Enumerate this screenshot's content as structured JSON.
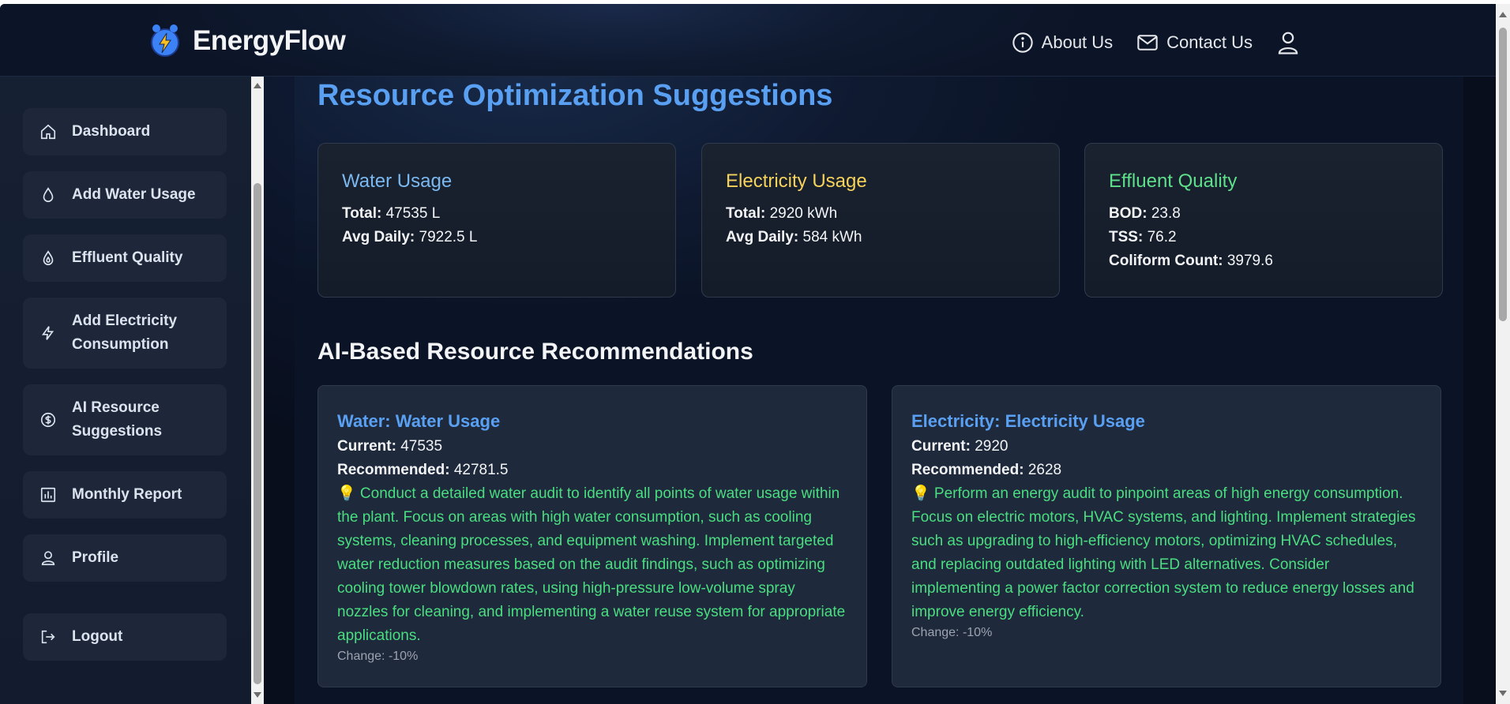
{
  "brand": {
    "name": "EnergyFlow"
  },
  "nav": {
    "about": "About Us",
    "contact": "Contact Us"
  },
  "sidebar": {
    "items": [
      {
        "label": "Dashboard",
        "icon": "home-icon"
      },
      {
        "label": "Add Water Usage",
        "icon": "droplet-icon"
      },
      {
        "label": "Effluent Quality",
        "icon": "flame-drop-icon"
      },
      {
        "label": "Add Electricity Consumption",
        "icon": "bolt-icon"
      },
      {
        "label": "AI Resource Suggestions",
        "icon": "dollar-circle-icon"
      },
      {
        "label": "Monthly Report",
        "icon": "bar-chart-icon"
      },
      {
        "label": "Profile",
        "icon": "user-icon"
      },
      {
        "label": "Logout",
        "icon": "logout-icon"
      }
    ]
  },
  "page": {
    "title": "Resource Optimization Suggestions"
  },
  "stats": {
    "water": {
      "title": "Water Usage",
      "total_label": "Total:",
      "total": "47535 L",
      "avg_label": "Avg Daily:",
      "avg": "7922.5 L",
      "color": "#7ab8ef"
    },
    "electricity": {
      "title": "Electricity Usage",
      "total_label": "Total:",
      "total": "2920 kWh",
      "avg_label": "Avg Daily:",
      "avg": "584 kWh",
      "color": "#f6d25a"
    },
    "effluent": {
      "title": "Effluent Quality",
      "bod_label": "BOD:",
      "bod": "23.8",
      "tss_label": "TSS:",
      "tss": "76.2",
      "coliform_label": "Coliform Count:",
      "coliform": "3979.6",
      "color": "#5ee08a"
    }
  },
  "recommendations": {
    "section_title": "AI-Based Resource Recommendations",
    "items": [
      {
        "title": "Water: Water Usage",
        "current_label": "Current:",
        "current": "47535",
        "recommended_label": "Recommended:",
        "recommended": "42781.5",
        "text": "💡 Conduct a detailed water audit to identify all points of water usage within the plant. Focus on areas with high water consumption, such as cooling systems, cleaning processes, and equipment washing. Implement targeted water reduction measures based on the audit findings, such as optimizing cooling tower blowdown rates, using high-pressure low-volume spray nozzles for cleaning, and implementing a water reuse system for appropriate applications.",
        "change": "Change: -10%"
      },
      {
        "title": "Electricity: Electricity Usage",
        "current_label": "Current:",
        "current": "2920",
        "recommended_label": "Recommended:",
        "recommended": "2628",
        "text": "💡 Perform an energy audit to pinpoint areas of high energy consumption. Focus on electric motors, HVAC systems, and lighting. Implement strategies such as upgrading to high-efficiency motors, optimizing HVAC schedules, and replacing outdated lighting with LED alternatives. Consider implementing a power factor correction system to reduce energy losses and improve energy efficiency.",
        "change": "Change: -10%"
      }
    ]
  }
}
